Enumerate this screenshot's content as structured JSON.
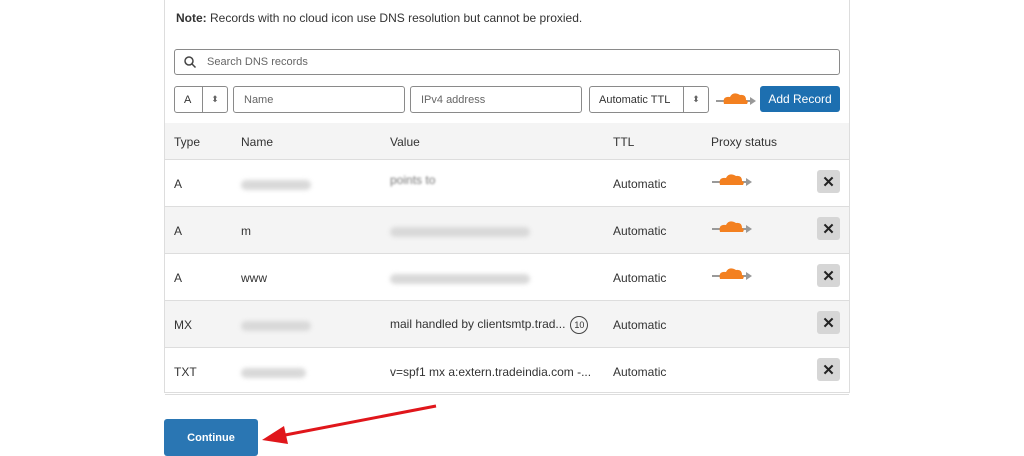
{
  "note": {
    "label": "Note:",
    "text": " Records with no cloud icon use DNS resolution but cannot be proxied."
  },
  "search": {
    "placeholder": "Search DNS records"
  },
  "form": {
    "type_value": "A",
    "name_placeholder": "Name",
    "value_placeholder": "IPv4 address",
    "ttl_value": "Automatic TTL",
    "add_label": "Add Record"
  },
  "table": {
    "headers": [
      "Type",
      "Name",
      "Value",
      "TTL",
      "Proxy status"
    ],
    "rows": [
      {
        "type": "A",
        "name": "",
        "value": "points to",
        "ttl": "Automatic",
        "proxied": true
      },
      {
        "type": "A",
        "name": "m",
        "value": "",
        "ttl": "Automatic",
        "proxied": true
      },
      {
        "type": "A",
        "name": "www",
        "value": "",
        "ttl": "Automatic",
        "proxied": true
      },
      {
        "type": "MX",
        "name": "",
        "value": "mail handled by clientsmtp.trad...",
        "priority": "10",
        "ttl": "Automatic",
        "proxied": false
      },
      {
        "type": "TXT",
        "name": "",
        "value": "v=spf1 mx a:extern.tradeindia.com -...",
        "ttl": "Automatic",
        "proxied": false
      }
    ]
  },
  "continue_label": "Continue",
  "colors": {
    "accent": "#1d6fb0",
    "cloud": "#f38020",
    "arrow": "#e0161b"
  }
}
